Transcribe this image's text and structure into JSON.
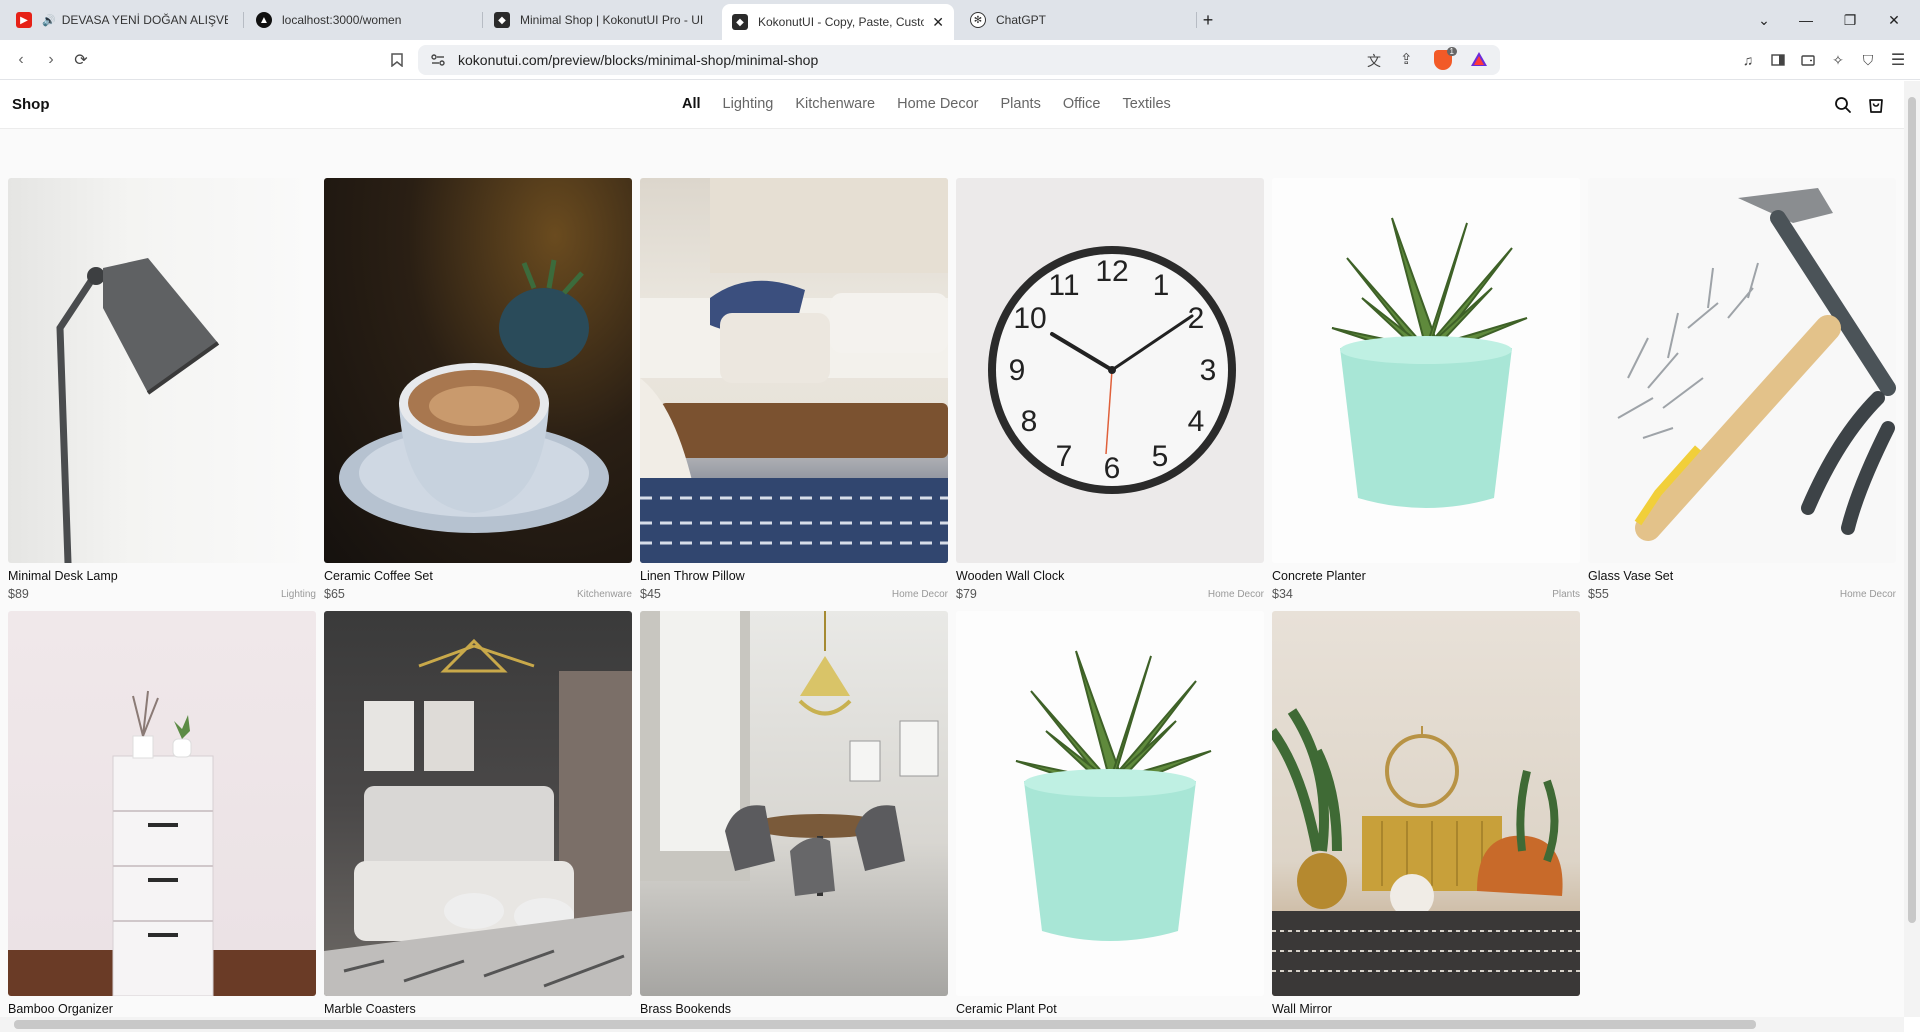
{
  "browser": {
    "tabs": [
      {
        "title": "DEVASA YENİ DOĞAN ALIŞVERİ",
        "icon": "youtube-icon"
      },
      {
        "title": "localhost:3000/women",
        "icon": "app-icon"
      },
      {
        "title": "Minimal Shop | KokonutUI Pro - UI C",
        "icon": "kokonut-icon"
      },
      {
        "title": "KokonutUI - Copy, Paste, Custo",
        "icon": "kokonut-icon",
        "active": true
      },
      {
        "title": "ChatGPT",
        "icon": "chatgpt-icon"
      }
    ],
    "new_tab": "+",
    "url": "kokonutui.com/preview/blocks/minimal-shop/minimal-shop",
    "shield_badge": "1"
  },
  "shop": {
    "brand": "Shop",
    "categories": [
      "All",
      "Lighting",
      "Kitchenware",
      "Home Decor",
      "Plants",
      "Office",
      "Textiles"
    ],
    "active_category": "All",
    "products": [
      {
        "name": "Minimal Desk Lamp",
        "price": "$89",
        "category": "Lighting",
        "image": "desk-lamp"
      },
      {
        "name": "Ceramic Coffee Set",
        "price": "$65",
        "category": "Kitchenware",
        "image": "coffee-cup"
      },
      {
        "name": "Linen Throw Pillow",
        "price": "$45",
        "category": "Home Decor",
        "image": "bedroom-pillows"
      },
      {
        "name": "Wooden Wall Clock",
        "price": "$79",
        "category": "Home Decor",
        "image": "wall-clock"
      },
      {
        "name": "Concrete Planter",
        "price": "$34",
        "category": "Plants",
        "image": "succulent-pot"
      },
      {
        "name": "Glass Vase Set",
        "price": "$55",
        "category": "Home Decor",
        "image": "tools"
      },
      {
        "name": "Bamboo Organizer",
        "image": "drawer-unit"
      },
      {
        "name": "Marble Coasters",
        "image": "bedroom"
      },
      {
        "name": "Brass Bookends",
        "image": "dining-room"
      },
      {
        "name": "Ceramic Plant Pot",
        "image": "succulent-pot"
      },
      {
        "name": "Wall Mirror",
        "image": "living-room"
      }
    ]
  }
}
